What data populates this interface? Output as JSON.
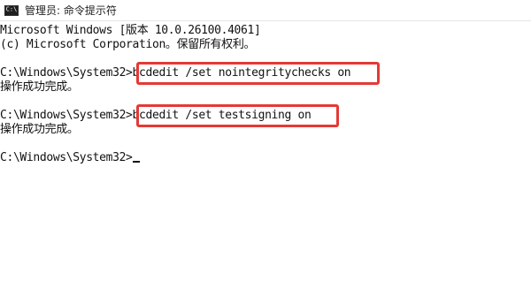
{
  "window": {
    "title": "管理员: 命令提示符",
    "icon": "terminal-icon",
    "icon_glyph": "C:\\"
  },
  "console": {
    "banner_line1": "Microsoft Windows [版本 10.0.26100.4061]",
    "banner_line2": "(c) Microsoft Corporation。保留所有权利。",
    "prompt": "C:\\Windows\\System32>",
    "commands": [
      {
        "command": "bcdedit /set nointegritychecks on",
        "result": "操作成功完成。",
        "highlighted": true
      },
      {
        "command": "bcdedit /set testsigning on",
        "result": "操作成功完成。",
        "highlighted": true
      }
    ],
    "current_input": ""
  },
  "colors": {
    "highlight_border": "#e53935",
    "console_text": "#111111",
    "background": "#ffffff"
  }
}
